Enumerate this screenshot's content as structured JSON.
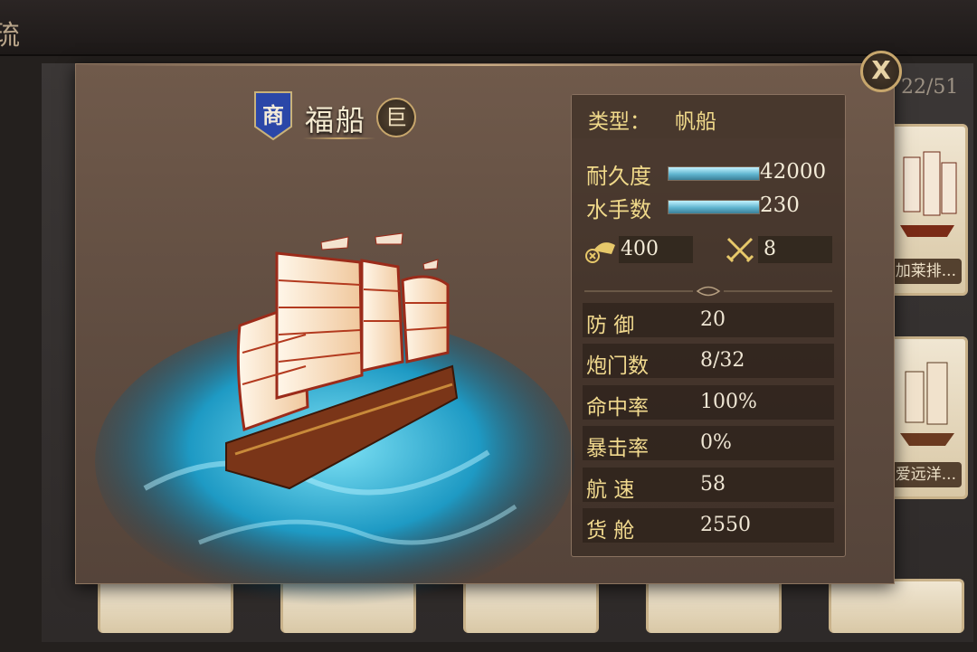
{
  "background": {
    "top_glyph": "琉",
    "counter": "22/51",
    "cards_right": [
      {
        "label": "加莱排..."
      },
      {
        "label": "爱远洋..."
      }
    ]
  },
  "dialog": {
    "close_label": "X",
    "category_badge": "商",
    "ship_name": "福船",
    "size_badge": "巨",
    "stats": {
      "type_label": "类型：",
      "type_value": "帆船",
      "durability": {
        "label": "耐久度",
        "value": "42000",
        "fill": 1.0
      },
      "crew": {
        "label": "水手数",
        "value": "230",
        "fill": 1.0
      },
      "cannon_value": "400",
      "melee_value": "8",
      "rows": [
        {
          "label": "防  御",
          "value": "20"
        },
        {
          "label": "炮门数",
          "value": "8/32"
        },
        {
          "label": "命中率",
          "value": "100%"
        },
        {
          "label": "暴击率",
          "value": "0%"
        },
        {
          "label": "航  速",
          "value": "58"
        },
        {
          "label": "货  舱",
          "value": "2550"
        }
      ]
    }
  },
  "colors": {
    "accent_gold": "#f0d98a",
    "bar_blue": "#5fb4cf",
    "badge_blue": "#2b47a8"
  }
}
